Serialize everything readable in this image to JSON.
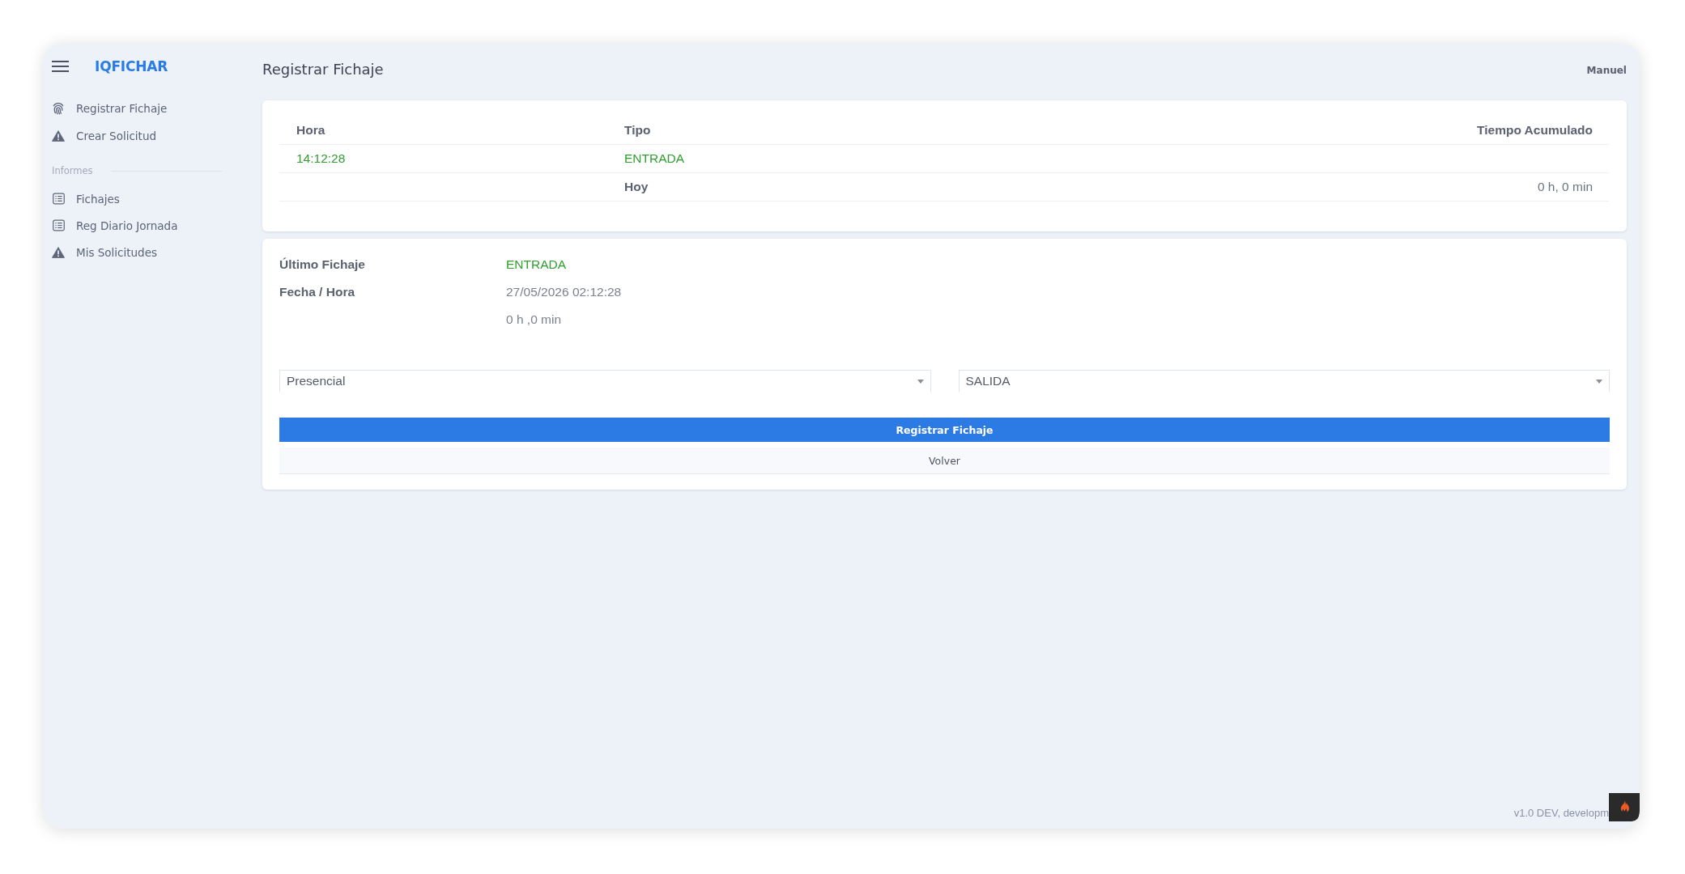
{
  "app": {
    "logo": "IQFICHAR"
  },
  "sidebar": {
    "groups": [
      {
        "items": [
          {
            "label": "Registrar Fichaje",
            "kind": "clock-in",
            "selected": false
          },
          {
            "label": "Crear Solicitud",
            "kind": "request",
            "selected": false
          }
        ]
      },
      {
        "heading": "Informes",
        "items": [
          {
            "label": "Fichajes",
            "kind": "report",
            "selected": false
          },
          {
            "label": "Reg Diario Jornada",
            "kind": "report",
            "selected": false
          },
          {
            "label": "Mis Solicitudes",
            "kind": "request",
            "selected": false
          }
        ]
      }
    ]
  },
  "header": {
    "title": "Registrar Fichaje",
    "user": "Manuel"
  },
  "entries_table": {
    "columns": [
      "Hora",
      "Tipo",
      "Tiempo Acumulado"
    ],
    "rows": [
      {
        "kind": "entry",
        "hora": "14:12:28",
        "tipo": "ENTRADA"
      },
      {
        "kind": "summary",
        "tipo": "Hoy",
        "tiempo_acumulado": "0 h, 0 min"
      }
    ]
  },
  "last_entry": {
    "rows": [
      {
        "kind": "entry",
        "label": "Último Fichaje",
        "value": "ENTRADA"
      },
      {
        "kind": "plain",
        "label": "Fecha / Hora",
        "value": "27/05/2026 02:12:28"
      },
      {
        "kind": "plain",
        "value": "0 h ,0 min"
      }
    ],
    "selects": [
      {
        "value": "Presencial"
      },
      {
        "value": "SALIDA"
      }
    ],
    "buttons": [
      {
        "kind": "primary",
        "label": "Registrar Fichaje"
      },
      {
        "kind": "secondary",
        "label": "Volver"
      }
    ]
  },
  "footer": {
    "version": "v1.0 DEV, developm"
  }
}
